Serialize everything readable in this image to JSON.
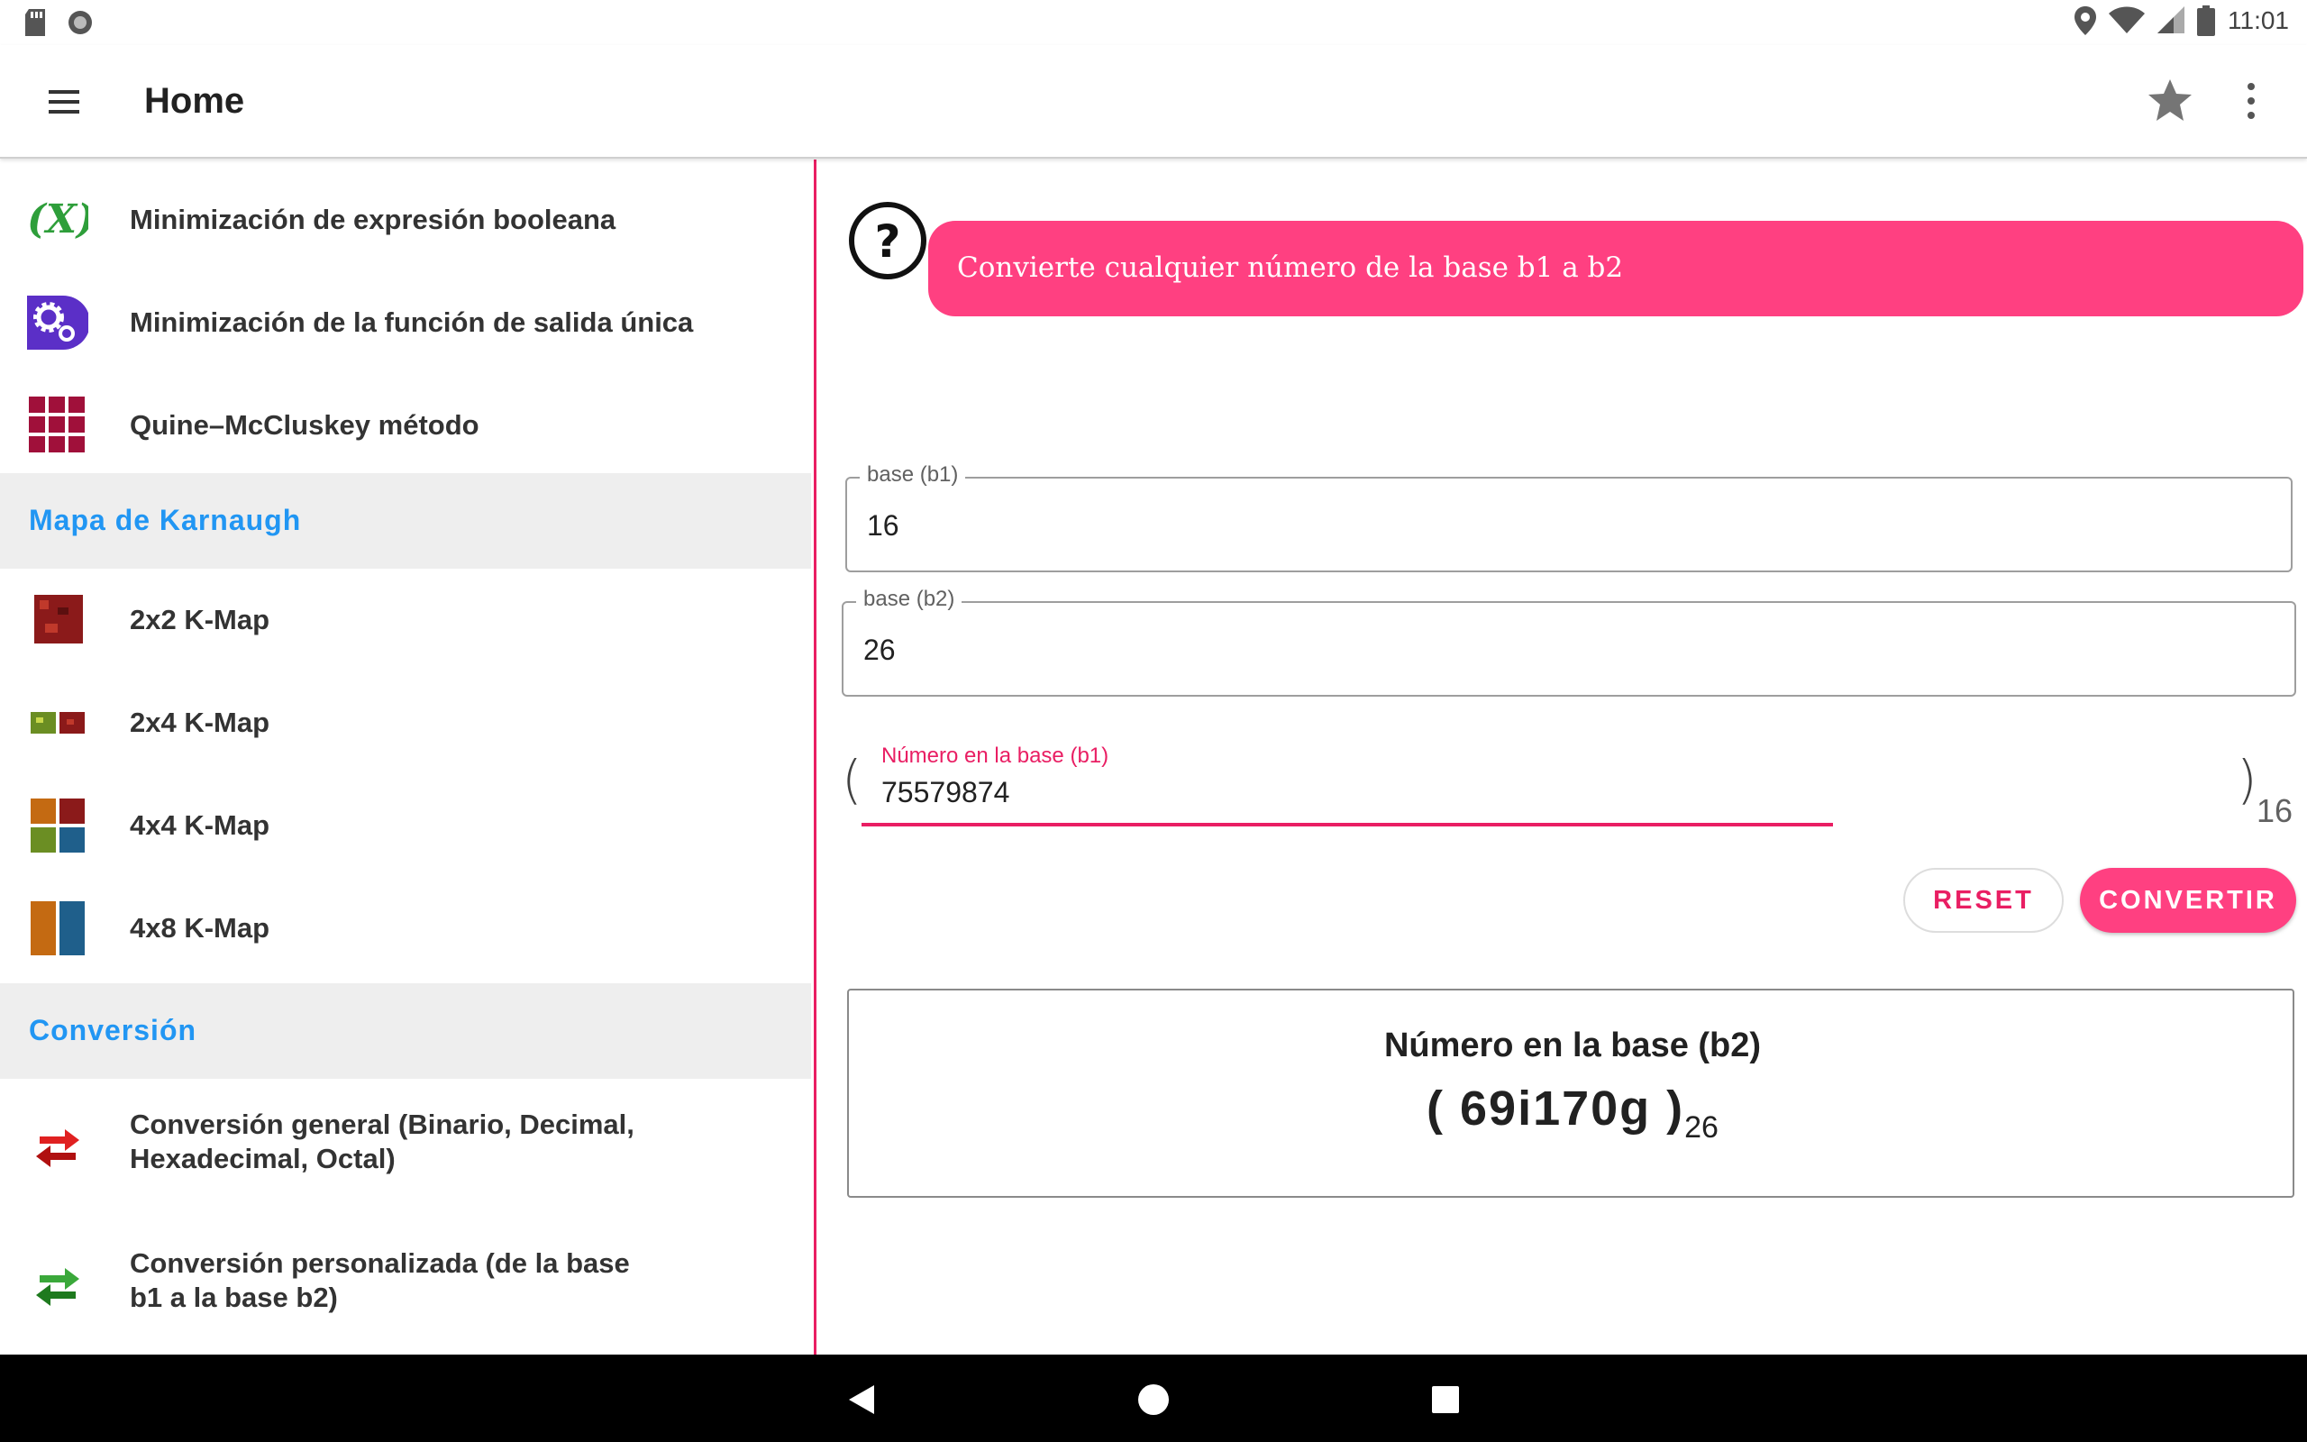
{
  "status_bar": {
    "time": "11:01"
  },
  "app_bar": {
    "title": "Home"
  },
  "sidebar": {
    "items_top": [
      {
        "label": "Minimización de expresión booleana",
        "icon": "boolean-function-icon"
      },
      {
        "label": "Minimización de la función de salida única",
        "icon": "gears-icon"
      },
      {
        "label": "Quine–McCluskey método",
        "icon": "grid-table-icon"
      }
    ],
    "section_kmap": {
      "title": "Mapa de Karnaugh",
      "items": [
        {
          "label": "2x2 K-Map",
          "icon": "kmap-2x2-icon"
        },
        {
          "label": "2x4 K-Map",
          "icon": "kmap-2x4-icon"
        },
        {
          "label": "4x4 K-Map",
          "icon": "kmap-4x4-icon"
        },
        {
          "label": "4x8 K-Map",
          "icon": "kmap-4x8-icon"
        }
      ]
    },
    "section_conversion": {
      "title": "Conversión",
      "items": [
        {
          "label_line1": "Conversión general (Binario, Decimal,",
          "label_line2": "Hexadecimal, Octal)",
          "icon": "red-arrows-icon"
        },
        {
          "label_line1": "Conversión personalizada (de la base",
          "label_line2": "b1 a la base b2)",
          "icon": "green-arrows-icon"
        }
      ]
    }
  },
  "main": {
    "banner_text": "Convierte cualquier número de la base b1 a b2",
    "base_b1": {
      "label": "base (b1)",
      "value": "16"
    },
    "base_b2": {
      "label": "base (b2)",
      "value": "26"
    },
    "number_input": {
      "label": "Número en la base (b1)",
      "value": "75579874",
      "open_paren": "(",
      "close_paren": ")",
      "base_subscript": "16"
    },
    "buttons": {
      "reset": "RESET",
      "convert": "CONVERTIR"
    },
    "result": {
      "title": "Número en la base (b2)",
      "value": "( 69i170g )",
      "base_subscript": "26"
    }
  },
  "colors": {
    "accent": "#ff4081",
    "accent_dark": "#e91e63",
    "section_text": "#2196f3",
    "section_bg": "#eeeeee"
  }
}
